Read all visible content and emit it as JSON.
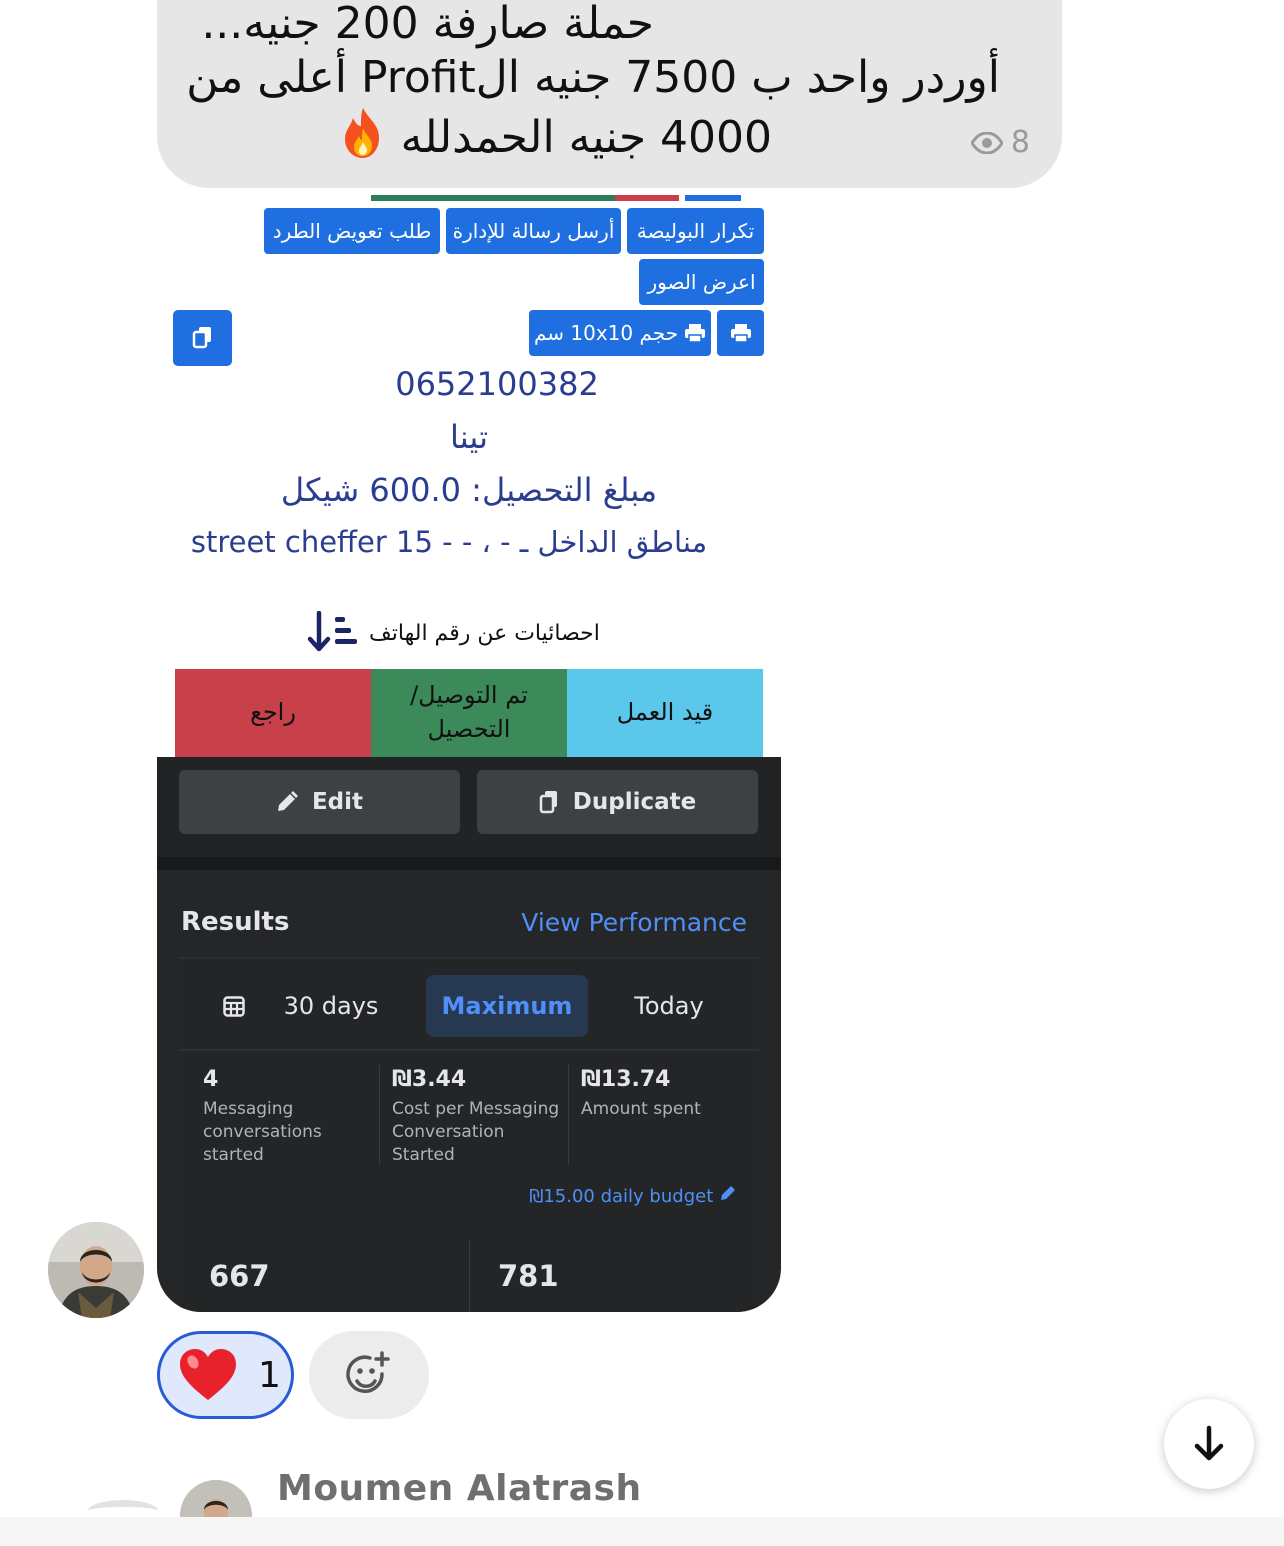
{
  "message": {
    "lines": [
      "حملة صارفة 200 جنيه...",
      "أوردر واحد ب 7500 جنيه الProfit أعلى من",
      "4000 جنيه الحمدلله"
    ],
    "emoji_icon": "fire-icon",
    "views": "8"
  },
  "attachment": {
    "buttons": {
      "repeat_policy": "تكرار البوليصة",
      "message_admin": "أرسل رسالة للإدارة",
      "parcel_compensation": "طلب تعويض الطرد",
      "show_images": "اعرض الصور",
      "print_size": "حجم 10x10 سم"
    },
    "phone": "0652100382",
    "name": "تينا",
    "collection_amount": "مبلغ التحصيل: 600.0 شيكل",
    "address": "مناطق الداخل  ـ  ‐ ، ‐ ‐  15  street cheffer",
    "stats_label": "احصائيات عن رقم الهاتف",
    "statuses": [
      "قيد العمل",
      "تم التوصيل/ التحصيل",
      "راجع"
    ],
    "status_colors": [
      "#5bc8eb",
      "#3c8a5a",
      "#c8404a"
    ]
  },
  "ad_panel": {
    "edit_label": "Edit",
    "duplicate_label": "Duplicate",
    "results_title": "Results",
    "view_performance": "View Performance",
    "tabs": [
      "30 days",
      "Maximum",
      "Today"
    ],
    "active_tab": "Maximum",
    "metrics": [
      {
        "value": "4",
        "label": "Messaging conversations started"
      },
      {
        "value": "₪3.44",
        "label": "Cost per Messaging Conversation Started"
      },
      {
        "value": "₪13.74",
        "label": "Amount spent"
      }
    ],
    "daily_budget": "₪15.00 daily budget",
    "bottom_numbers": [
      "667",
      "781"
    ]
  },
  "reactions": {
    "heart_icon": "heart-icon",
    "heart_count": "1",
    "add_reaction_icon": "add-reaction-icon"
  },
  "next_sender": {
    "name": "Moumen Alatrash"
  },
  "colors": {
    "bubble": "#e6e6e6",
    "button_blue": "#1f6fe0",
    "link_blue": "#4f8ff7",
    "dark_panel": "#252627"
  }
}
